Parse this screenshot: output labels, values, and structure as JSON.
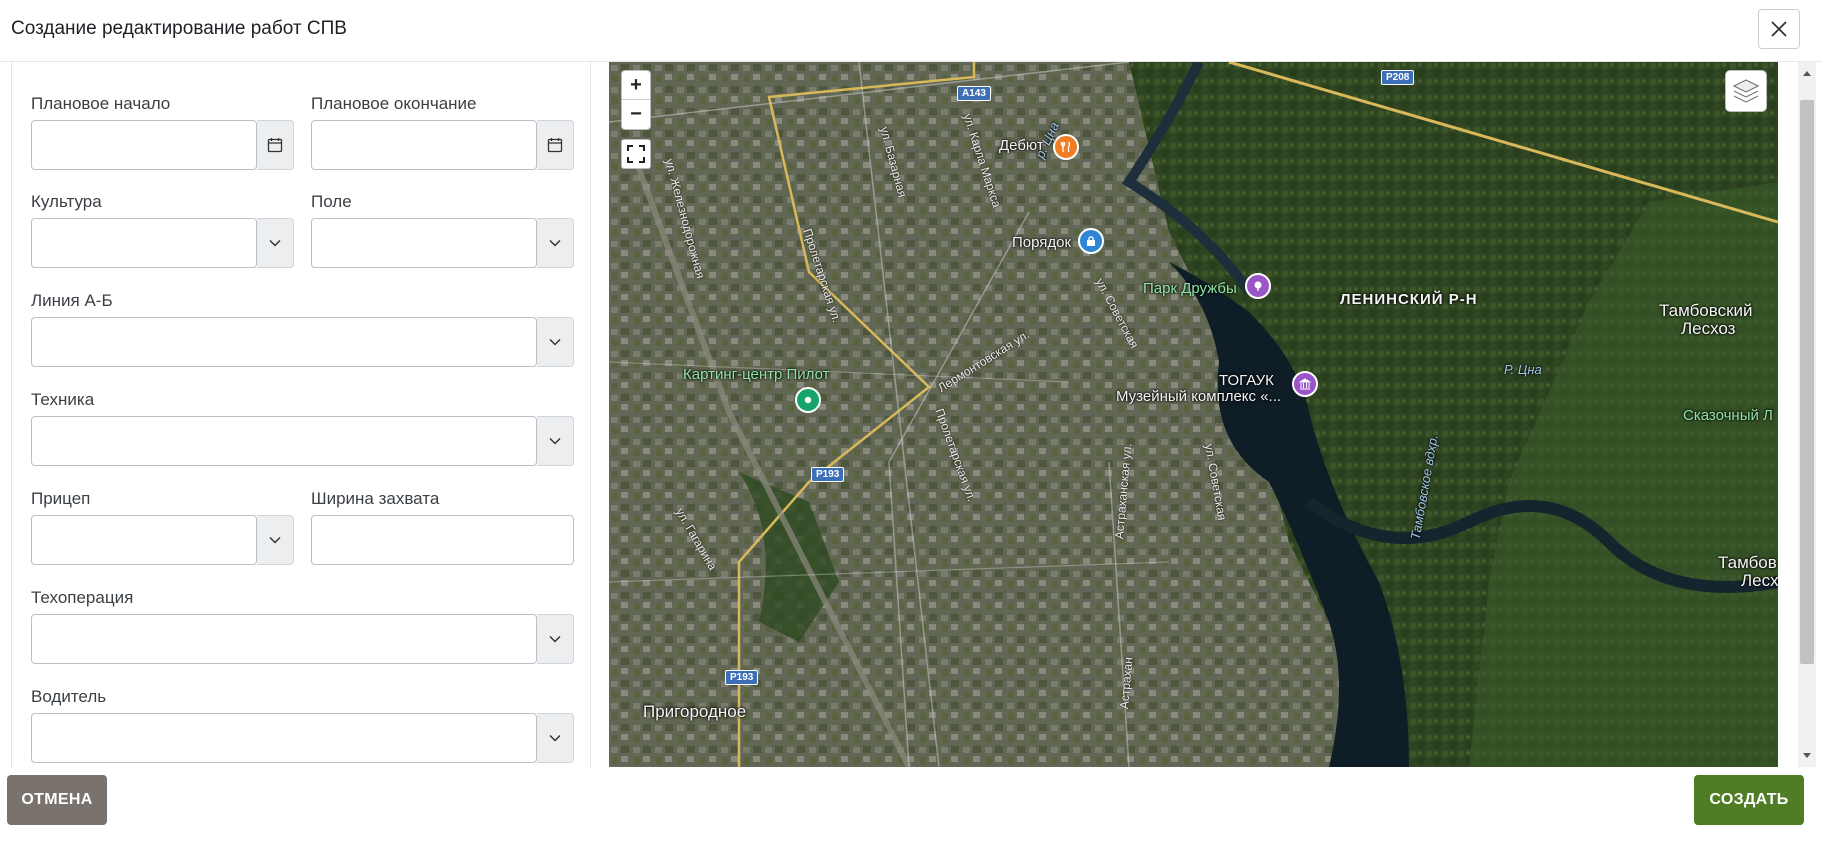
{
  "dialog": {
    "title": "Создание редактирование работ СПВ"
  },
  "form": {
    "planned_start": {
      "label": "Плановое начало",
      "value": ""
    },
    "planned_end": {
      "label": "Плановое окончание",
      "value": ""
    },
    "culture": {
      "label": "Культура",
      "value": ""
    },
    "field": {
      "label": "Поле",
      "value": ""
    },
    "ab_line": {
      "label": "Линия А-Б",
      "value": ""
    },
    "machinery": {
      "label": "Техника",
      "value": ""
    },
    "trailer": {
      "label": "Прицеп",
      "value": ""
    },
    "working_width": {
      "label": "Ширина захвата",
      "value": ""
    },
    "tech_operation": {
      "label": "Техоперация",
      "value": ""
    },
    "driver": {
      "label": "Водитель",
      "value": ""
    }
  },
  "map": {
    "zoom_in": "+",
    "zoom_out": "−",
    "labels": {
      "debut": "Дебют",
      "poryadok": "Порядок",
      "park": "Парк Дружбы",
      "district": "ЛЕНИНСКИЙ Р-Н",
      "forest1": "Тамбовский",
      "forest1b": "Лесхоз",
      "karting": "Картинг-центр Пилот",
      "togauk": "ТОГАУК",
      "museum": "Музейный комплекс «...",
      "river": "Р. Цна",
      "river2": "р. Цна",
      "skazochny": "Сказочный Л",
      "reservoir": "Тамбовское вдхр.",
      "forest2": "Тамбов",
      "forest2b": "Лесх",
      "prigorodnoe": "Пригородное"
    },
    "streets": {
      "proletarskaya": "Пролетарская ул.",
      "proletarskaya2": "Пролетарская ул.",
      "zheleznodorozhnaya": "ул. Железнодорожная",
      "bazarnaya": "ул. Базарная",
      "karla_marksa": "ул. Карла Маркса",
      "lermontovskaya": "Лермонтовская ул.",
      "sovetskaya": "ул. Советская",
      "sovetskaya2": "ул. Советская",
      "astrakhanskaya": "Астраханская ул.",
      "gagarina": "ул. Гагарина",
      "astrakhan2": "Астрахан"
    },
    "shields": {
      "a143": "А143",
      "r208": "Р208",
      "r193a": "Р193",
      "r193b": "Р193"
    }
  },
  "footer": {
    "cancel": "ОТМЕНА",
    "create": "СОЗДАТЬ"
  },
  "colors": {
    "primary": "#4f7d23",
    "cancel": "#7a726c"
  }
}
